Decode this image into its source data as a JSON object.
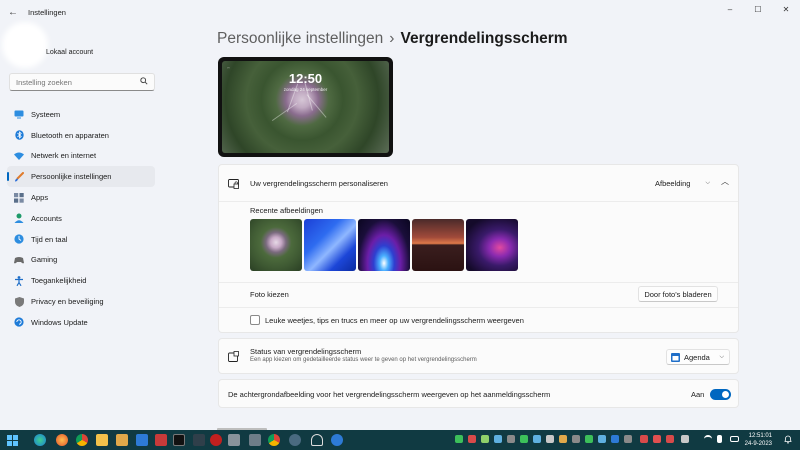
{
  "window": {
    "title": "Instellingen",
    "back_icon": "back-arrow-icon",
    "controls": {
      "minimize": "–",
      "maximize": "☐",
      "close": "✕"
    }
  },
  "account": {
    "name": "Lokaal account"
  },
  "search": {
    "placeholder": "Instelling zoeken",
    "icon": "search-icon"
  },
  "sidebar": {
    "items": [
      {
        "label": "Systeem",
        "icon": "system-icon",
        "color": "#1e7bd8"
      },
      {
        "label": "Bluetooth en apparaten",
        "icon": "bluetooth-icon",
        "color": "#1e7bd8"
      },
      {
        "label": "Netwerk en internet",
        "icon": "network-icon",
        "color": "#1e7bd8"
      },
      {
        "label": "Persoonlijke instellingen",
        "icon": "personalization-brush-icon",
        "color": "#e07b2c",
        "active": true
      },
      {
        "label": "Apps",
        "icon": "apps-icon",
        "color": "#5a6f8a"
      },
      {
        "label": "Accounts",
        "icon": "accounts-icon",
        "color": "#1e9a6a"
      },
      {
        "label": "Tijd en taal",
        "icon": "time-language-icon",
        "color": "#1e7bd8"
      },
      {
        "label": "Gaming",
        "icon": "gaming-icon",
        "color": "#6b6b6b"
      },
      {
        "label": "Toegankelijkheid",
        "icon": "accessibility-icon",
        "color": "#1e6ec8"
      },
      {
        "label": "Privacy en beveiliging",
        "icon": "shield-icon",
        "color": "#6b6b6b"
      },
      {
        "label": "Windows Update",
        "icon": "windows-update-icon",
        "color": "#1e7bd8"
      }
    ]
  },
  "breadcrumb": {
    "parent": "Persoonlijke instellingen",
    "separator": "›",
    "current": "Vergrendelingsscherm"
  },
  "preview": {
    "time": "12:50",
    "date": "zondag 24 september"
  },
  "personalize": {
    "label": "Uw vergrendelingsscherm personaliseren",
    "icon": "lock-screen-icon",
    "dropdown_value": "Afbeelding",
    "recent_label": "Recente afbeeldingen",
    "browse_label": "Foto kiezen",
    "browse_button": "Door foto's bladeren",
    "tips_label": "Leuke weetjes, tips en trucs en meer op uw vergrendelingsscherm weergeven",
    "tips_checked": false
  },
  "status": {
    "label": "Status van vergrendelingsscherm",
    "description": "Een app kiezen om gedetailleerde status weer te geven op het vergrendelingsscherm",
    "icon": "lock-status-icon",
    "dropdown_value": "Agenda",
    "dropdown_icon": "calendar-icon"
  },
  "signin_background": {
    "label": "De achtergrondafbeelding voor het vergrendelingsscherm weergeven op het aanmeldingsscherm",
    "toggle_label": "Aan",
    "toggle_on": true
  },
  "accent_color": "#0067c0",
  "taskbar": {
    "time": "12:51:01",
    "date": "24-9-2023"
  }
}
